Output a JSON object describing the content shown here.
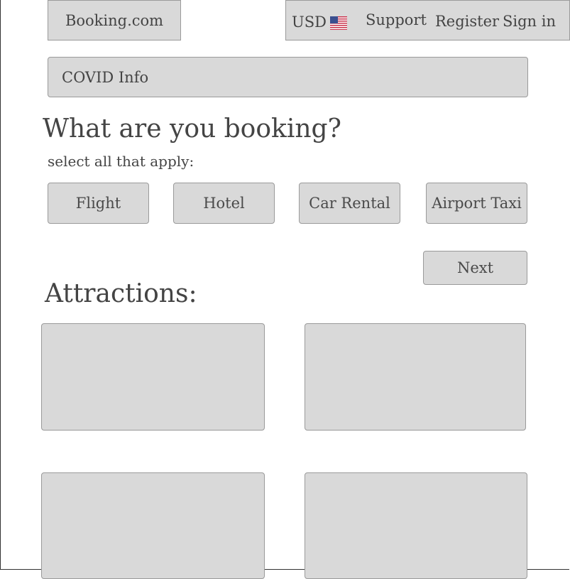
{
  "header": {
    "logo": "Booking.com",
    "currency": "USD",
    "flag_icon": "us-flag-icon",
    "support": "Support",
    "register": "Register",
    "sign_in": "Sign in"
  },
  "banner": {
    "covid": "COVID Info"
  },
  "booking": {
    "title": "What are you booking?",
    "subtitle": "select all that apply:",
    "options": [
      "Flight",
      "Hotel",
      "Car Rental",
      "Airport Taxi"
    ],
    "next": "Next"
  },
  "attractions": {
    "title": "Attractions:"
  },
  "colors": {
    "box_fill": "#d9d9d9",
    "box_border": "#9a9a9a",
    "text": "#444444"
  }
}
